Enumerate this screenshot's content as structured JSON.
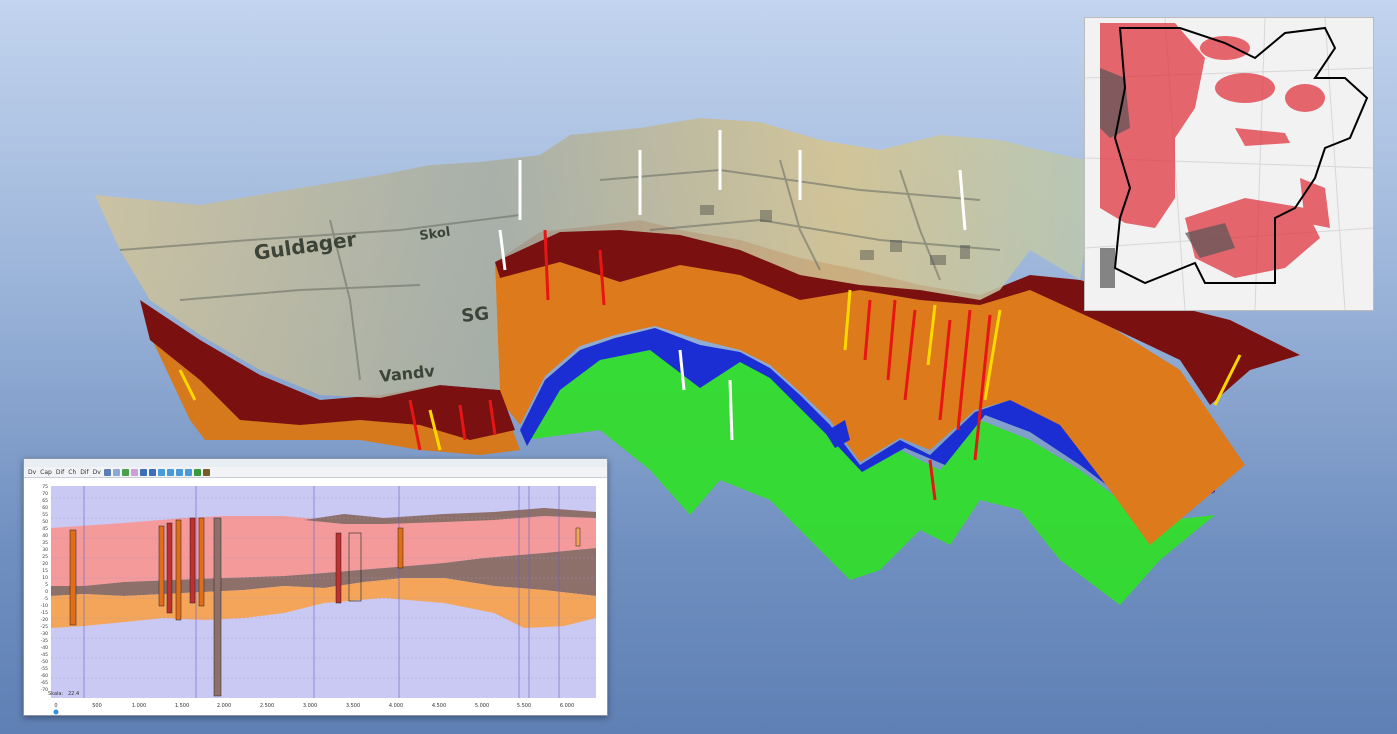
{
  "scene": {
    "terrain_labels": [
      "Guldager",
      "Skol",
      "Vandv",
      "SG"
    ],
    "layer_colors": {
      "terrain": "#d7c8a0",
      "clay_dark": "#7a0f0f",
      "sand": "#d9791a",
      "blue": "#1c2fd6",
      "green": "#2fdc2a"
    }
  },
  "section_window": {
    "toolbar": [
      "Dv",
      "Cap",
      "Dif",
      "Ch",
      "Dif",
      "Dv"
    ],
    "y_axis": [
      "75",
      "70",
      "65",
      "60",
      "55",
      "50",
      "45",
      "40",
      "35",
      "30",
      "25",
      "20",
      "15",
      "10",
      "5",
      "0",
      "-5",
      "-10",
      "-15",
      "-20",
      "-25",
      "-30",
      "-35",
      "-40",
      "-45",
      "-50",
      "-55",
      "-60",
      "-65",
      "-70",
      "-75",
      "-80"
    ],
    "x_axis": [
      "0",
      "500",
      "1.000",
      "1.500",
      "2.000",
      "2.500",
      "3.000",
      "3.500",
      "4.000",
      "4.500",
      "5.000",
      "5.500",
      "6.000",
      "6.500"
    ],
    "status_label": "Skala:",
    "status_value": "22.4",
    "colors": {
      "top": "#f49a9a",
      "brown": "#8e706b",
      "orange": "#f5a55a",
      "bottom": "#c9c9f3"
    }
  },
  "map_inset": {
    "heat_color": "#e0363f",
    "boundary_color": "#000000"
  }
}
